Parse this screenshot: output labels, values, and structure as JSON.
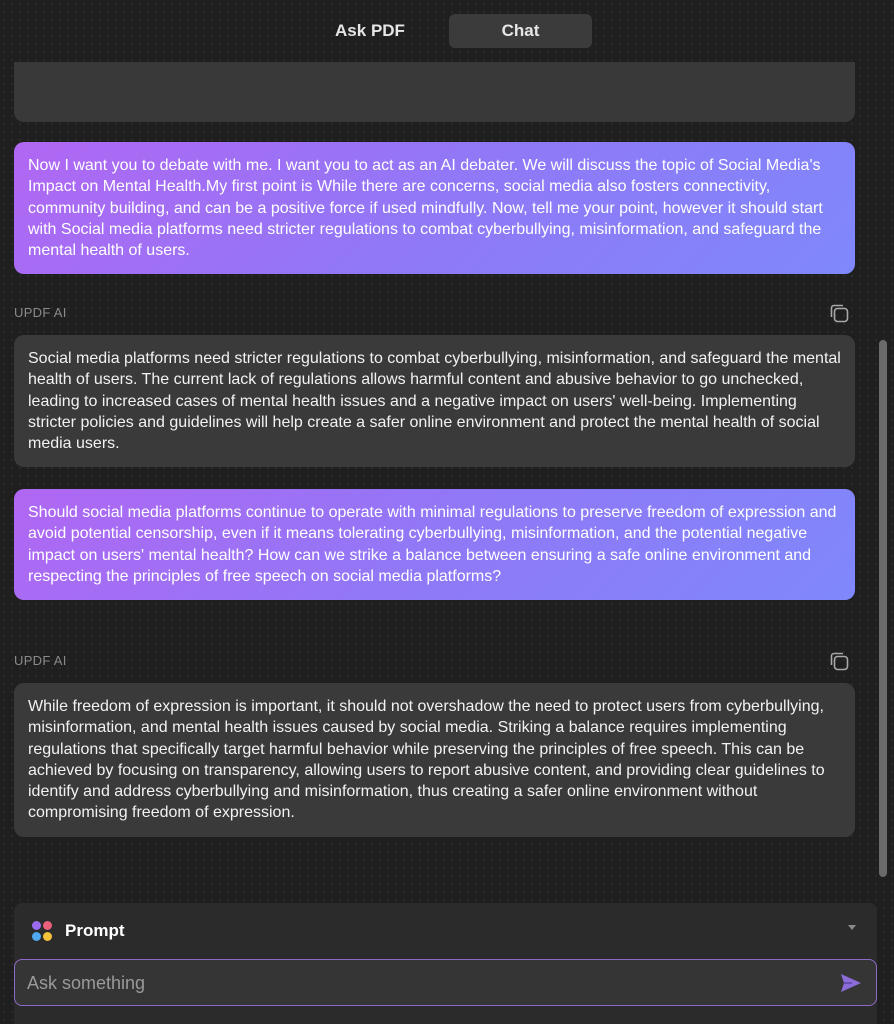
{
  "tabs": {
    "ask_pdf": "Ask PDF",
    "chat": "Chat",
    "active": "Chat"
  },
  "messages": [
    {
      "role": "user",
      "text": "Now I want you to debate with me. I want you to act as an AI debater. We will discuss the topic of Social Media's Impact on Mental Health.My first point is While there are concerns, social media also fosters connectivity, community building, and can be a positive force if used mindfully. Now, tell me your point, however it should start with  Social media platforms need stricter regulations to combat cyberbullying, misinformation, and safeguard the mental health of users."
    },
    {
      "role": "ai",
      "label": "UPDF AI",
      "text": "Social media platforms need stricter regulations to combat cyberbullying, misinformation, and safeguard the mental health of users. The current lack of regulations allows harmful content and abusive behavior to go unchecked, leading to increased cases of mental health issues and a negative impact on users' well-being. Implementing stricter policies and guidelines will help create a safer online environment and protect the mental health of social media users."
    },
    {
      "role": "user",
      "text": "Should social media platforms continue to operate with minimal regulations to preserve freedom of expression and avoid potential censorship, even if it means tolerating cyberbullying, misinformation, and the potential negative impact on users' mental health? How can we strike a balance between ensuring a safe online environment and respecting the principles of free speech on social media platforms?"
    },
    {
      "role": "ai",
      "label": "UPDF AI",
      "text": "While freedom of expression is important, it should not overshadow the need to protect users from cyberbullying, misinformation, and mental health issues caused by social media. Striking a balance requires implementing regulations that specifically target harmful behavior while preserving the principles of free speech. This can be achieved by focusing on transparency, allowing users to report abusive content, and providing clear guidelines to identify and address cyberbullying and misinformation, thus creating a safer online environment without compromising freedom of expression."
    }
  ],
  "prompt": {
    "label": "Prompt",
    "icon": "prompt-dots-icon"
  },
  "input": {
    "placeholder": "Ask something",
    "value": ""
  },
  "colors": {
    "background": "#1f1f1f",
    "ai_bubble": "#3a3a3a",
    "user_gradient_start": "#b167f3",
    "user_gradient_end": "#7f88fb",
    "input_border": "#8e6ac8",
    "send_icon": "#8b6cd9"
  }
}
